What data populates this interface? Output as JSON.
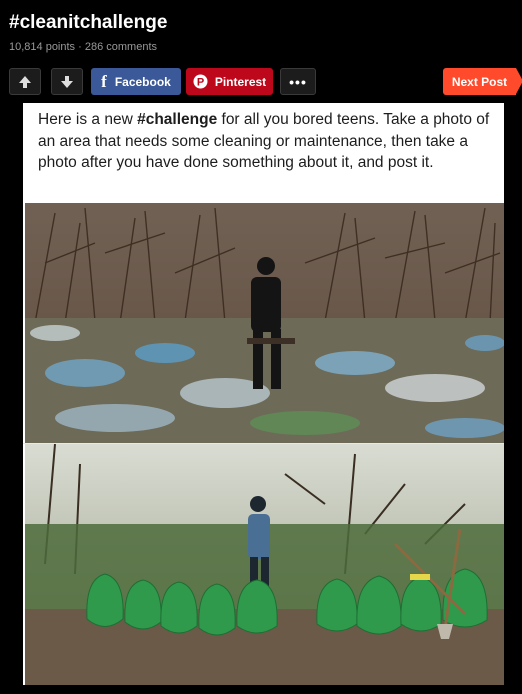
{
  "post": {
    "title": "#cleanitchallenge",
    "points": "10,814 points",
    "separator": "·",
    "comments": "286 comments"
  },
  "actions": {
    "upvote_icon": "arrow-up-icon",
    "downvote_icon": "arrow-down-icon",
    "facebook_label": "Facebook",
    "pinterest_label": "Pinterest",
    "more_label": "•••",
    "next_label": "Next Post"
  },
  "image": {
    "caption_pre": "Here is a new ",
    "caption_bold": "#challenge",
    "caption_post": " for all you bored teens. Take a photo of an area that needs some cleaning or maintenance, then take a photo after you have done something about it, and post it."
  },
  "colors": {
    "facebook": "#3b5998",
    "pinterest": "#bd081c",
    "next": "#ff4b2b",
    "background": "#000000"
  }
}
